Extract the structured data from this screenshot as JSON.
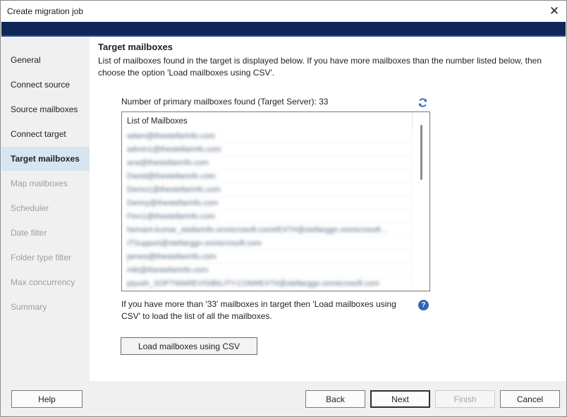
{
  "window": {
    "title": "Create migration job"
  },
  "sidebar": {
    "items": [
      {
        "label": "General",
        "state": "normal"
      },
      {
        "label": "Connect source",
        "state": "normal"
      },
      {
        "label": "Source mailboxes",
        "state": "normal"
      },
      {
        "label": "Connect target",
        "state": "normal"
      },
      {
        "label": "Target mailboxes",
        "state": "active"
      },
      {
        "label": "Map mailboxes",
        "state": "disabled"
      },
      {
        "label": "Scheduler",
        "state": "disabled"
      },
      {
        "label": "Date filter",
        "state": "disabled"
      },
      {
        "label": "Folder type filter",
        "state": "disabled"
      },
      {
        "label": "Max concurrency",
        "state": "disabled"
      },
      {
        "label": "Summary",
        "state": "disabled"
      }
    ]
  },
  "main": {
    "title": "Target mailboxes",
    "description": "List of mailboxes found in the target is displayed below. If you have more mailboxes than the number listed below, then choose the option 'Load mailboxes using CSV'.",
    "count_label": "Number of primary mailboxes found (Target Server): 33",
    "list": {
      "header": "List of Mailboxes",
      "rows": [
        "adam@thestellarinfo.com",
        "admin1@thestellarinfo.com",
        "ana@thestellarinfo.com",
        "David@thestellarinfo.com",
        "Demo1@thestellarinfo.com",
        "Denny@thestellarinfo.com",
        "Finn1@thestellarinfo.com",
        "hemant.kumar_stellarinfo.onmicrosoft.com#EXT#@stellarggn.onmicrosoft...",
        "ITSupport@stellarggn.onmicrosoft.com",
        "james@thestellarinfo.com",
        "mkt@thestellarinfo.com",
        "piyush_SOFTWAREVISIBILITY.COM#EXT#@stellarggn.onmicrosoft.com"
      ]
    },
    "info_text": "If you have more than '33' mailboxes in target then 'Load mailboxes using CSV' to load the list of all the mailboxes.",
    "csv_button": "Load mailboxes using CSV"
  },
  "footer": {
    "help": "Help",
    "back": "Back",
    "next": "Next",
    "finish": "Finish",
    "cancel": "Cancel"
  },
  "colors": {
    "banner": "#0e2758",
    "active_nav": "#d7e4f2",
    "accent": "#2f64b6"
  }
}
